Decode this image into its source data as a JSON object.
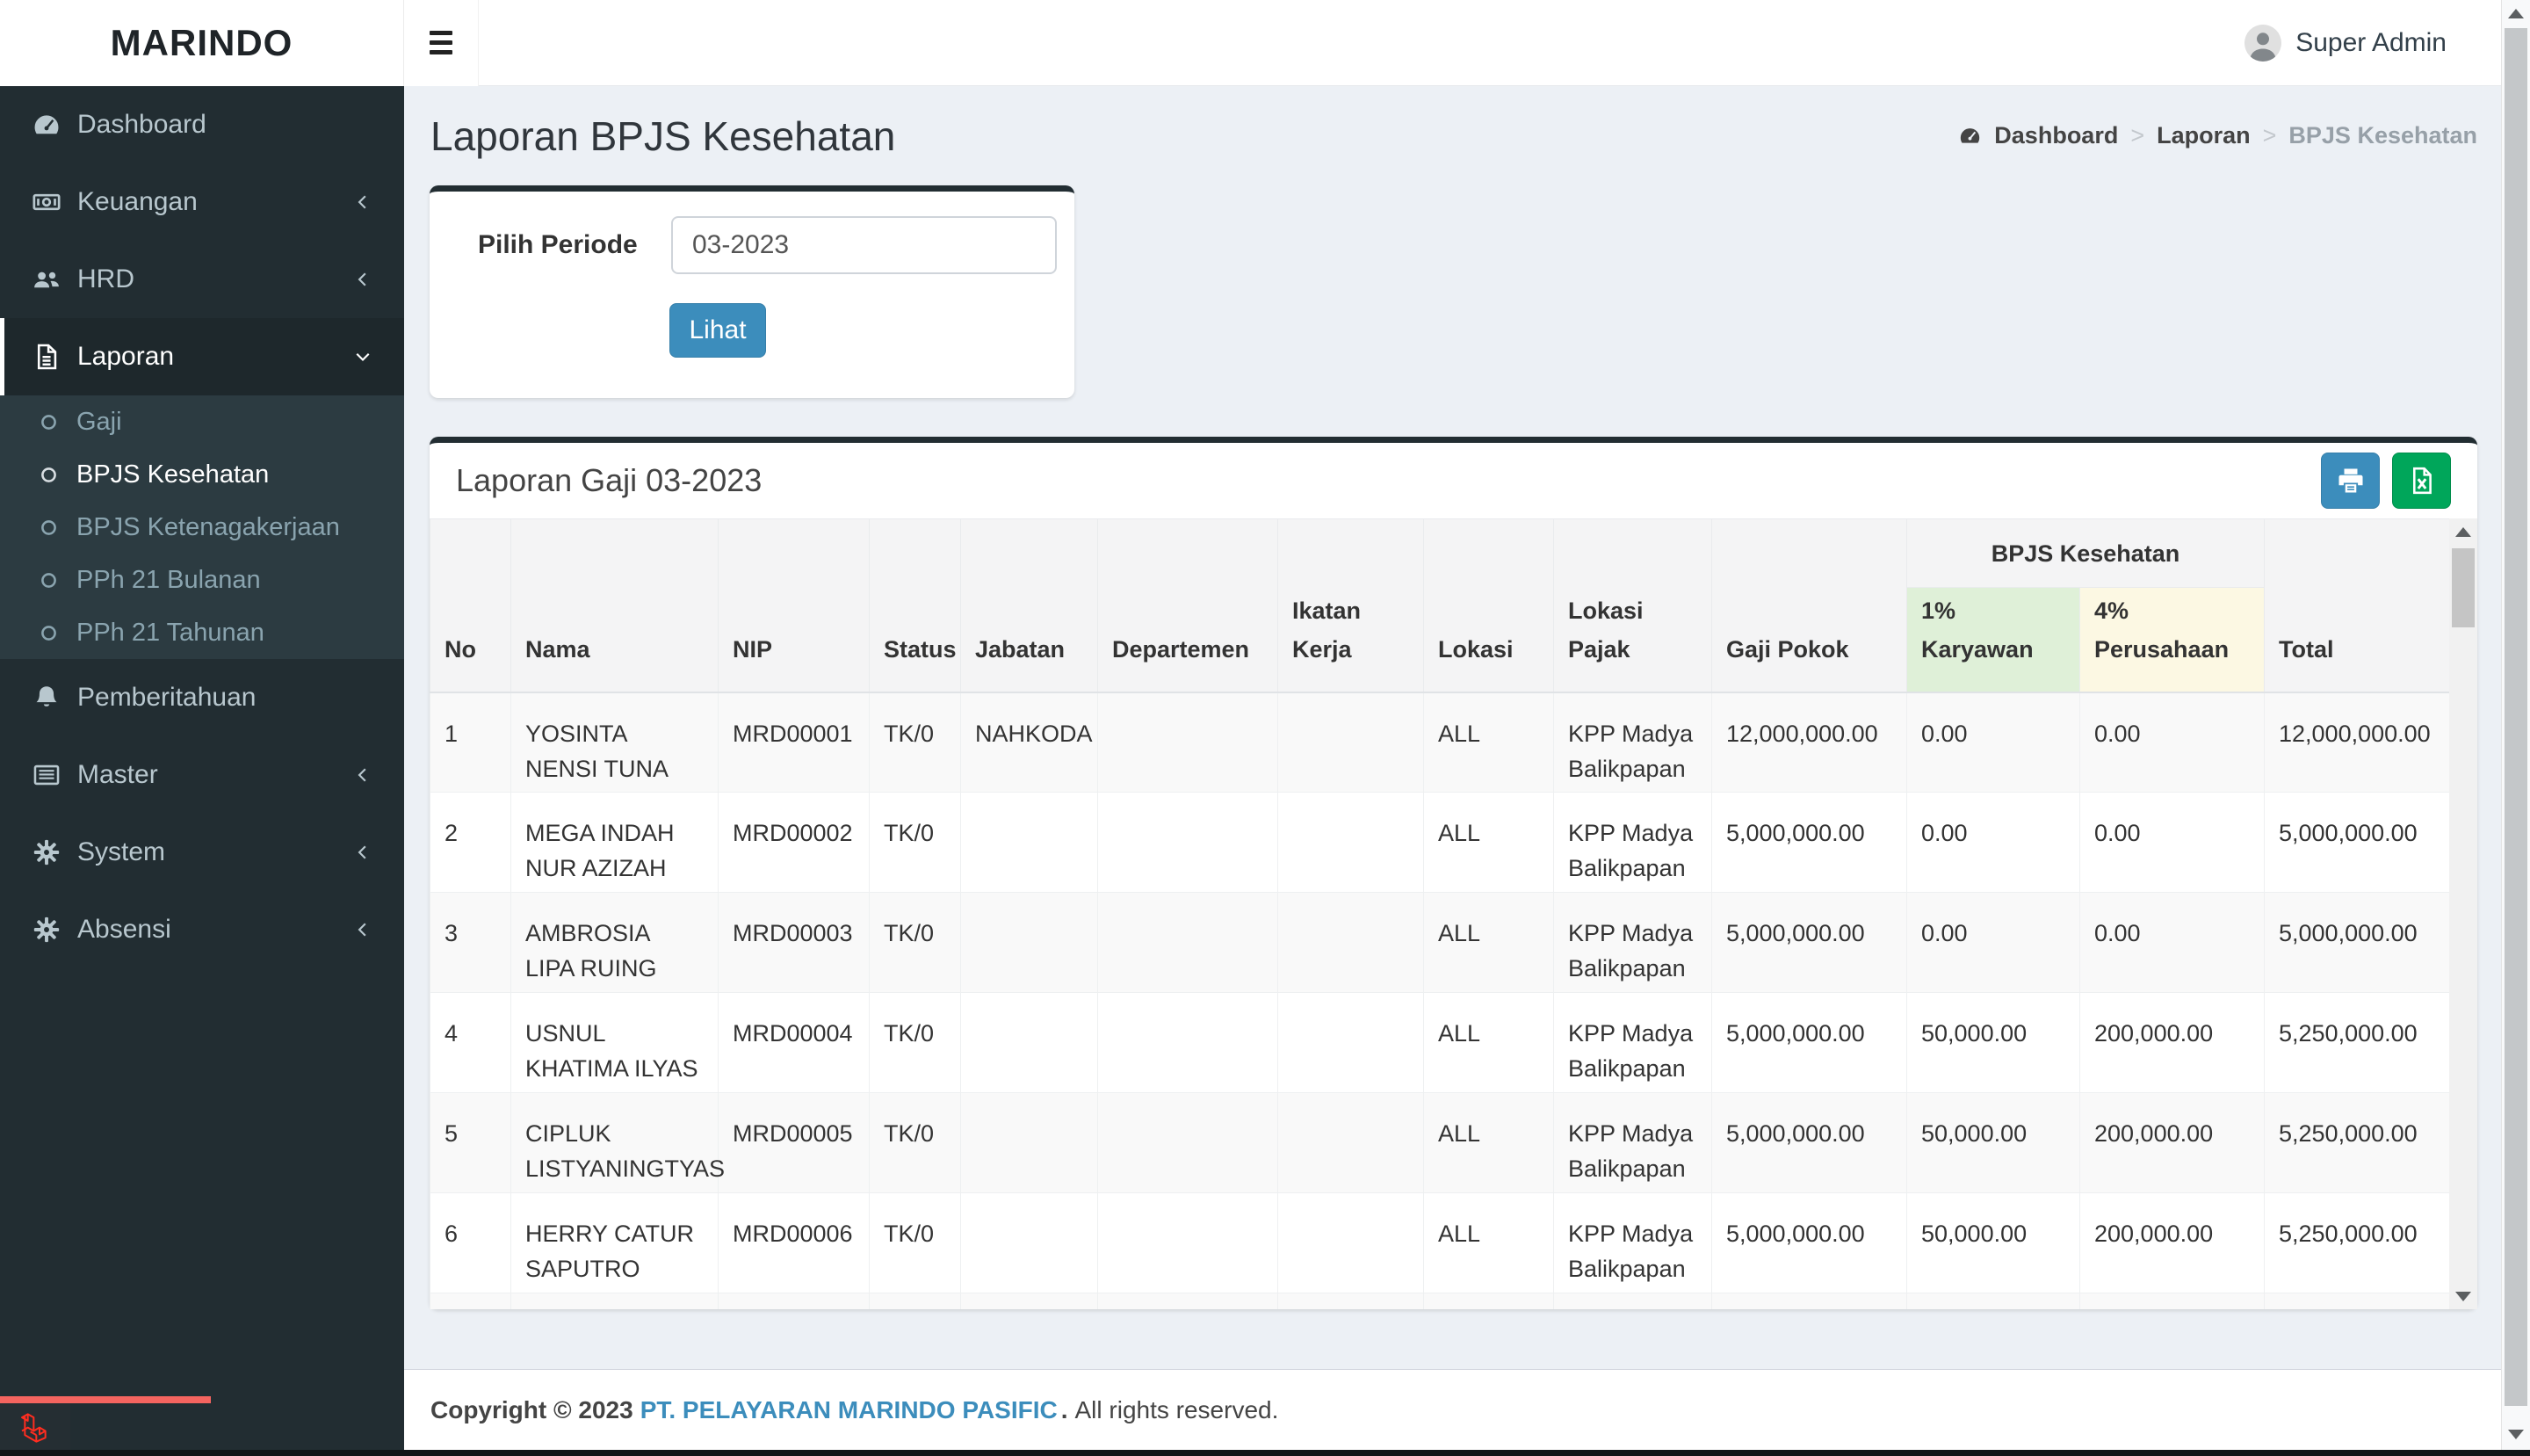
{
  "sidebar": {
    "brand": "MARINDO",
    "items": [
      {
        "label": "Dashboard",
        "icon": "tachometer-icon"
      },
      {
        "label": "Keuangan",
        "icon": "money-icon",
        "chevron": "left"
      },
      {
        "label": "HRD",
        "icon": "users-icon",
        "chevron": "left"
      },
      {
        "label": "Laporan",
        "icon": "file-text-icon",
        "chevron": "down",
        "active": true,
        "submenu": [
          {
            "label": "Gaji"
          },
          {
            "label": "BPJS Kesehatan",
            "active": true
          },
          {
            "label": "BPJS Ketenagakerjaan"
          },
          {
            "label": "PPh 21 Bulanan"
          },
          {
            "label": "PPh 21 Tahunan"
          }
        ]
      },
      {
        "label": "Pemberitahuan",
        "icon": "bell-icon"
      },
      {
        "label": "Master",
        "icon": "list-icon",
        "chevron": "left"
      },
      {
        "label": "System",
        "icon": "gear-icon",
        "chevron": "left"
      },
      {
        "label": "Absensi",
        "icon": "gear-icon",
        "chevron": "left"
      }
    ]
  },
  "header": {
    "user": "Super Admin",
    "menu_icon": "hamburger-icon",
    "avatar_icon": "user-avatar"
  },
  "page": {
    "title": "Laporan BPJS Kesehatan"
  },
  "breadcrumb": {
    "icon": "tachometer-icon",
    "items": [
      "Dashboard",
      "Laporan",
      "BPJS Kesehatan"
    ]
  },
  "filter": {
    "label": "Pilih Periode",
    "value": "03-2023",
    "button": "Lihat"
  },
  "report": {
    "title": "Laporan Gaji 03-2023",
    "print_icon": "printer-icon",
    "excel_icon": "file-excel-icon",
    "group_header": "BPJS Kesehatan",
    "columns": [
      "No",
      "Nama",
      "NIP",
      "Status",
      "Jabatan",
      "Departemen",
      "Ikatan Kerja",
      "Lokasi",
      "Lokasi Pajak",
      "Gaji Pokok",
      "1% Karyawan",
      "4% Perusahaan",
      "Total"
    ],
    "rows": [
      [
        "1",
        "YOSINTA NENSI TUNA",
        "MRD00001",
        "TK/0",
        "NAHKODA",
        "",
        "",
        "ALL",
        "KPP Madya Balikpapan",
        "12,000,000.00",
        "0.00",
        "0.00",
        "12,000,000.00"
      ],
      [
        "2",
        "MEGA INDAH NUR AZIZAH",
        "MRD00002",
        "TK/0",
        "",
        "",
        "",
        "ALL",
        "KPP Madya Balikpapan",
        "5,000,000.00",
        "0.00",
        "0.00",
        "5,000,000.00"
      ],
      [
        "3",
        "AMBROSIA LIPA RUING",
        "MRD00003",
        "TK/0",
        "",
        "",
        "",
        "ALL",
        "KPP Madya Balikpapan",
        "5,000,000.00",
        "0.00",
        "0.00",
        "5,000,000.00"
      ],
      [
        "4",
        "USNUL KHATIMA ILYAS",
        "MRD00004",
        "TK/0",
        "",
        "",
        "",
        "ALL",
        "KPP Madya Balikpapan",
        "5,000,000.00",
        "50,000.00",
        "200,000.00",
        "5,250,000.00"
      ],
      [
        "5",
        "CIPLUK LISTYANINGTYAS",
        "MRD00005",
        "TK/0",
        "",
        "",
        "",
        "ALL",
        "KPP Madya Balikpapan",
        "5,000,000.00",
        "50,000.00",
        "200,000.00",
        "5,250,000.00"
      ],
      [
        "6",
        "HERRY CATUR SAPUTRO",
        "MRD00006",
        "TK/0",
        "",
        "",
        "",
        "ALL",
        "KPP Madya Balikpapan",
        "5,000,000.00",
        "50,000.00",
        "200,000.00",
        "5,250,000.00"
      ]
    ]
  },
  "footer": {
    "prefix": "Copyright © 2023",
    "company": "PT. PELAYARAN MARINDO PASIFIC",
    "dot": ".",
    "suffix": "All rights reserved."
  },
  "theme": {
    "primary": "#3c8dbc",
    "success": "#00a65a",
    "sidebar_bg": "#222d32",
    "sidebar_submenu_bg": "#2c3b41",
    "content_bg": "#ecf0f5",
    "karyawan_header_bg": "#dff0d8",
    "perusahaan_header_bg": "#fcf8e3",
    "card_top_border": "#222d32",
    "laravel_red": "#ff2d20"
  }
}
